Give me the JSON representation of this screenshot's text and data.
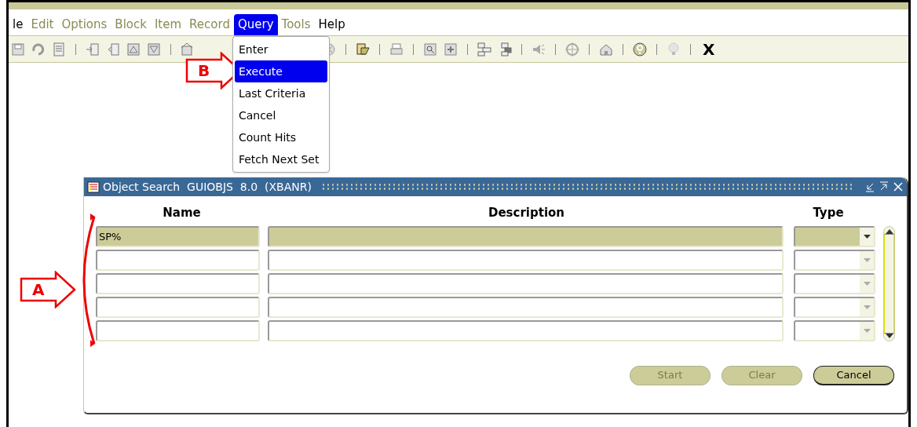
{
  "menu_bar": [
    {
      "label": "le",
      "disabled": false,
      "selected": false
    },
    {
      "label": "Edit",
      "disabled": true,
      "selected": false
    },
    {
      "label": "Options",
      "disabled": true,
      "selected": false
    },
    {
      "label": "Block",
      "disabled": true,
      "selected": false
    },
    {
      "label": "Item",
      "disabled": true,
      "selected": false
    },
    {
      "label": "Record",
      "disabled": true,
      "selected": false
    },
    {
      "label": "Query",
      "disabled": false,
      "selected": true
    },
    {
      "label": "Tools",
      "disabled": true,
      "selected": false
    },
    {
      "label": "Help",
      "disabled": false,
      "selected": false
    }
  ],
  "query_menu": [
    {
      "label": "Enter",
      "selected": false
    },
    {
      "label": "Execute",
      "selected": true
    },
    {
      "label": "Last Criteria",
      "selected": false
    },
    {
      "label": "Cancel",
      "selected": false
    },
    {
      "label": "Count Hits",
      "selected": false
    },
    {
      "label": "Fetch Next Set",
      "selected": false
    }
  ],
  "toolbar": {
    "exit_label": "X"
  },
  "callouts": [
    {
      "label": "A"
    },
    {
      "label": "B"
    }
  ],
  "dialog": {
    "title": "Object Search  GUIOBJS  8.0  (XBANR)",
    "columns": [
      "Name",
      "Description",
      "Type"
    ],
    "rows": [
      {
        "name": "SP%",
        "description": "",
        "selected": true
      },
      {
        "name": "",
        "description": "",
        "selected": false
      },
      {
        "name": "",
        "description": "",
        "selected": false
      },
      {
        "name": "",
        "description": "",
        "selected": false
      },
      {
        "name": "",
        "description": "",
        "selected": false
      }
    ],
    "buttons": [
      {
        "label": "Start",
        "disabled": true
      },
      {
        "label": "Clear",
        "disabled": true
      },
      {
        "label": "Cancel",
        "disabled": false
      }
    ]
  }
}
